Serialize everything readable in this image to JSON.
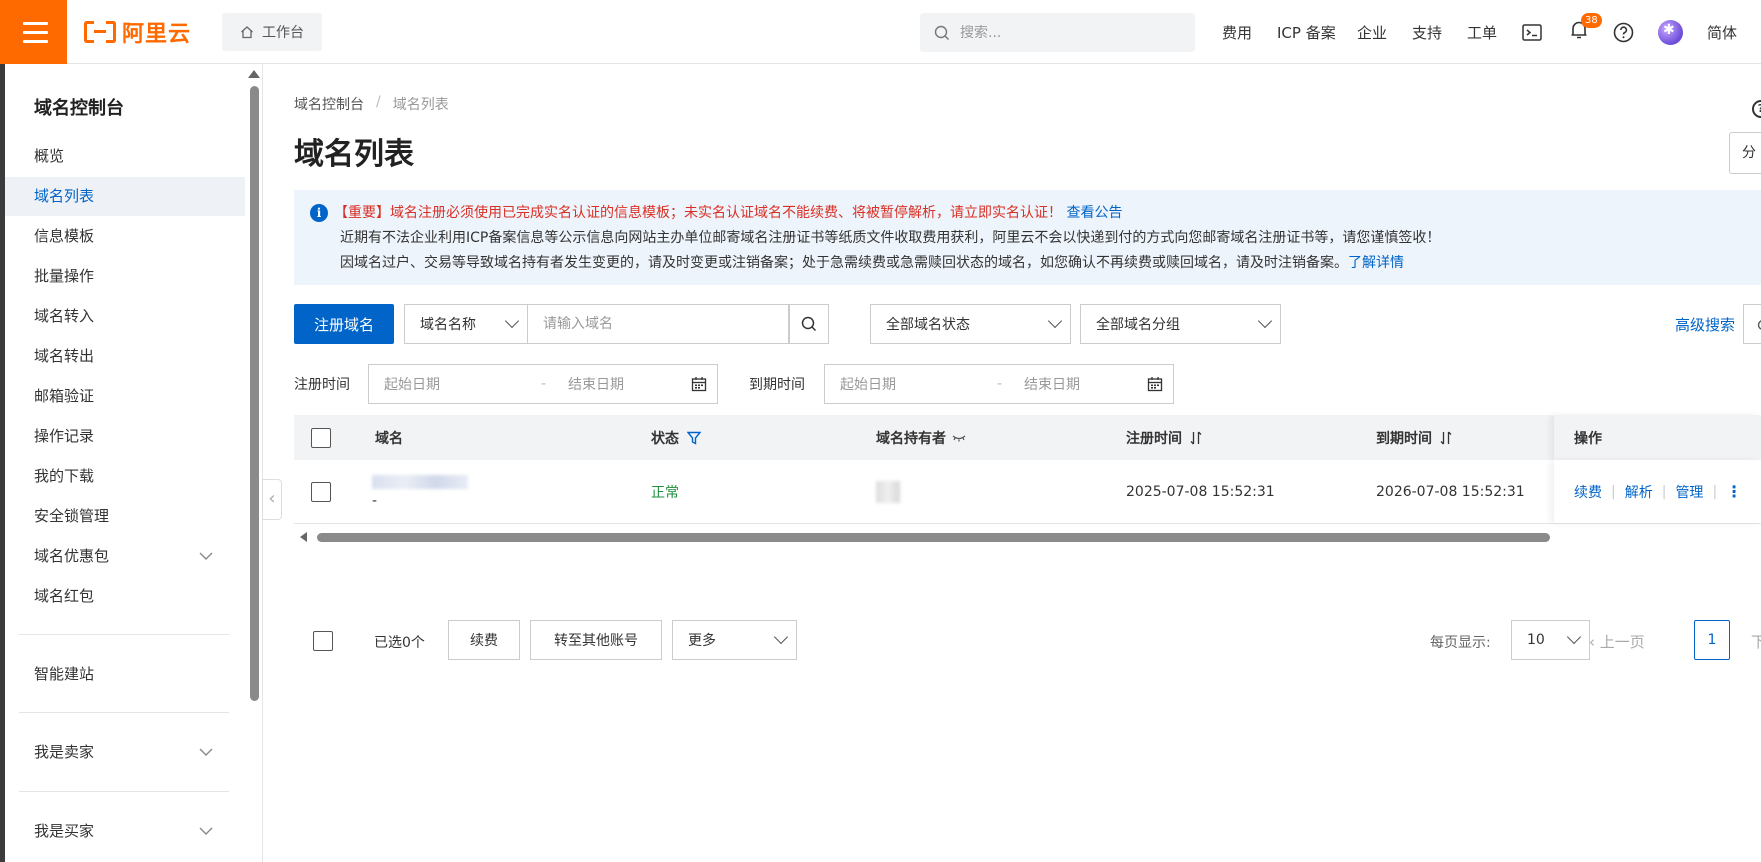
{
  "header": {
    "logo_text": "阿里云",
    "workbench_label": "工作台",
    "search_placeholder": "搜索...",
    "nav": [
      "费用",
      "ICP 备案",
      "企业",
      "支持",
      "工单"
    ],
    "notification_count": "38",
    "language": "简体"
  },
  "sidebar": {
    "title": "域名控制台",
    "items": [
      {
        "label": "概览"
      },
      {
        "label": "域名列表",
        "active": true
      },
      {
        "label": "信息模板"
      },
      {
        "label": "批量操作"
      },
      {
        "label": "域名转入"
      },
      {
        "label": "域名转出"
      },
      {
        "label": "邮箱验证"
      },
      {
        "label": "操作记录"
      },
      {
        "label": "我的下载"
      },
      {
        "label": "安全锁管理"
      },
      {
        "label": "域名优惠包",
        "expandable": true
      },
      {
        "label": "域名红包"
      }
    ],
    "section2": {
      "label": "智能建站"
    },
    "section3": {
      "label": "我是卖家"
    },
    "section4": {
      "label": "我是买家"
    }
  },
  "breadcrumb": {
    "root": "域名控制台",
    "sep": "/",
    "current": "域名列表"
  },
  "page_title": "域名列表",
  "share_button_partial": "分",
  "notice": {
    "important_prefix": "【重要】",
    "line1": "域名注册必须使用已完成实名认证的信息模板；未实名认证域名不能续费、将被暂停解析，请立即实名认证！",
    "line1_link": "查看公告",
    "line2": "近期有不法企业利用ICP备案信息等公示信息向网站主办单位邮寄域名注册证书等纸质文件收取费用获利，阿里云不会以快递到付的方式向您邮寄域名注册证书等，请您谨慎签收！",
    "line3": "因域名过户、交易等导致域名持有者发生变更的，请及时变更或注销备案；处于急需续费或急需赎回状态的域名，如您确认不再续费或赎回域名，请及时注销备案。",
    "line3_link": "了解详情"
  },
  "toolbar": {
    "register_button": "注册域名",
    "search_type": "域名名称",
    "search_placeholder": "请输入域名",
    "status_filter": "全部域名状态",
    "group_filter": "全部域名分组",
    "advanced_search": "高级搜索"
  },
  "date_filters": {
    "register_label": "注册时间",
    "expire_label": "到期时间",
    "start_placeholder": "起始日期",
    "dash": "-",
    "end_placeholder": "结束日期"
  },
  "table": {
    "columns": [
      "域名",
      "状态",
      "域名持有者",
      "注册时间",
      "到期时间",
      "操作"
    ],
    "rows": [
      {
        "domain_sub": "-",
        "status": "正常",
        "register_time": "2025-07-08 15:52:31",
        "expire_time": "2026-07-08 15:52:31",
        "actions": [
          "续费",
          "解析",
          "管理"
        ]
      }
    ]
  },
  "footer": {
    "selected": "已选0个",
    "renew_button": "续费",
    "transfer_button": "转至其他账号",
    "more_select": "更多",
    "page_size_label": "每页显示:",
    "page_size": "10",
    "prev": "上一页",
    "current_page": "1",
    "next_partial": "下"
  },
  "colors": {
    "brand": "#ff6a00",
    "primary": "#0064c8",
    "success": "#1e8e3e",
    "danger": "#d93026"
  }
}
